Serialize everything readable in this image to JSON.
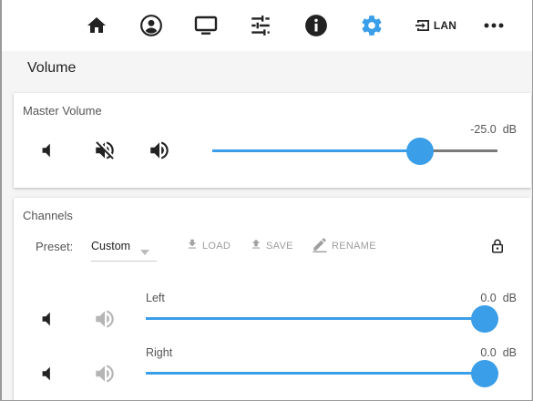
{
  "nav": {
    "items": [
      {
        "icon": "home-icon"
      },
      {
        "icon": "account-icon"
      },
      {
        "icon": "monitor-icon"
      },
      {
        "icon": "equalizer-icon"
      },
      {
        "icon": "info-icon"
      },
      {
        "icon": "gear-icon",
        "active": true
      },
      {
        "icon": "input-icon",
        "label": "LAN"
      },
      {
        "icon": "more-icon"
      }
    ],
    "lan_label": "LAN",
    "accent": "#3a9ee8"
  },
  "page": {
    "title": "Volume"
  },
  "master": {
    "title": "Master Volume",
    "db_value": "-25.0",
    "db_unit": "dB",
    "level": 0.73
  },
  "channels": {
    "title": "Channels",
    "preset_label": "Preset:",
    "preset_value": "Custom",
    "actions": {
      "load": "LOAD",
      "save": "SAVE",
      "rename": "RENAME"
    },
    "items": [
      {
        "name": "Left",
        "db_value": "0.0",
        "db_unit": "dB",
        "level": 1.0
      },
      {
        "name": "Right",
        "db_value": "0.0",
        "db_unit": "dB",
        "level": 1.0
      }
    ]
  },
  "colors": {
    "accent": "#3a9ee8",
    "icon_dark": "#222222",
    "icon_muted": "#b5b5b5"
  }
}
